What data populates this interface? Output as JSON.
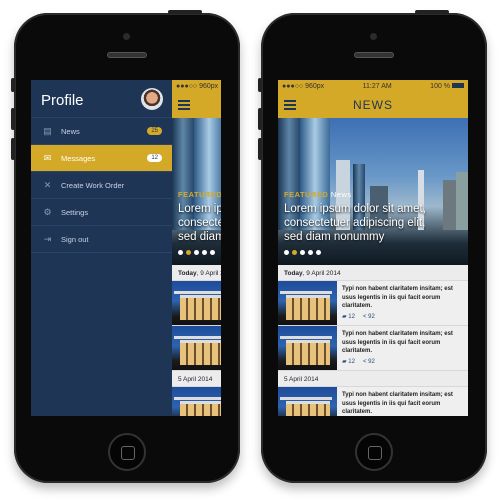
{
  "status": {
    "carrier": "●●●○○ 960px",
    "wifi": "wifi-icon",
    "time": "11:27 AM",
    "battery": "100 %"
  },
  "menu": {
    "title": "Profile",
    "items": [
      {
        "label": "News",
        "icon": "newspaper-icon",
        "badge": "25",
        "active": false
      },
      {
        "label": "Messages",
        "icon": "envelope-icon",
        "badge": "12",
        "active": true
      },
      {
        "label": "Create Work Order",
        "icon": "tools-icon",
        "active": false
      },
      {
        "label": "Settings",
        "icon": "gear-icon",
        "active": false
      },
      {
        "label": "Sign out",
        "icon": "sign-out-icon",
        "active": false
      }
    ]
  },
  "news": {
    "title": "NEWS",
    "featured": {
      "tag": "FEATURED",
      "category": "News",
      "line1": "Lorem ipsum dolor sit amet,",
      "line2": "consectetuer adipiscing elit,",
      "line3": "sed diam nonummy",
      "slides": 5,
      "active_slide": 2
    },
    "groups": [
      {
        "date_bold": "Today",
        "date_rest": ", 9 April 2014",
        "items": [
          {
            "text": "Typi non habent claritatem insitam; est usus legentis in iis qui facit eorum claritatem.",
            "comments": "12",
            "shares": "92"
          },
          {
            "text": "Typi non habent claritatem insitam; est usus legentis in iis qui facit eorum claritatem.",
            "comments": "12",
            "shares": "92"
          }
        ]
      },
      {
        "date_bold": "",
        "date_rest": "5 April 2014",
        "items": [
          {
            "text": "Typi non habent claritatem insitam; est usus legentis in iis qui facit eorum claritatem."
          }
        ]
      }
    ]
  },
  "colors": {
    "accent": "#d4a927",
    "navy": "#1f3556",
    "list_bg": "#e9e9e9"
  }
}
